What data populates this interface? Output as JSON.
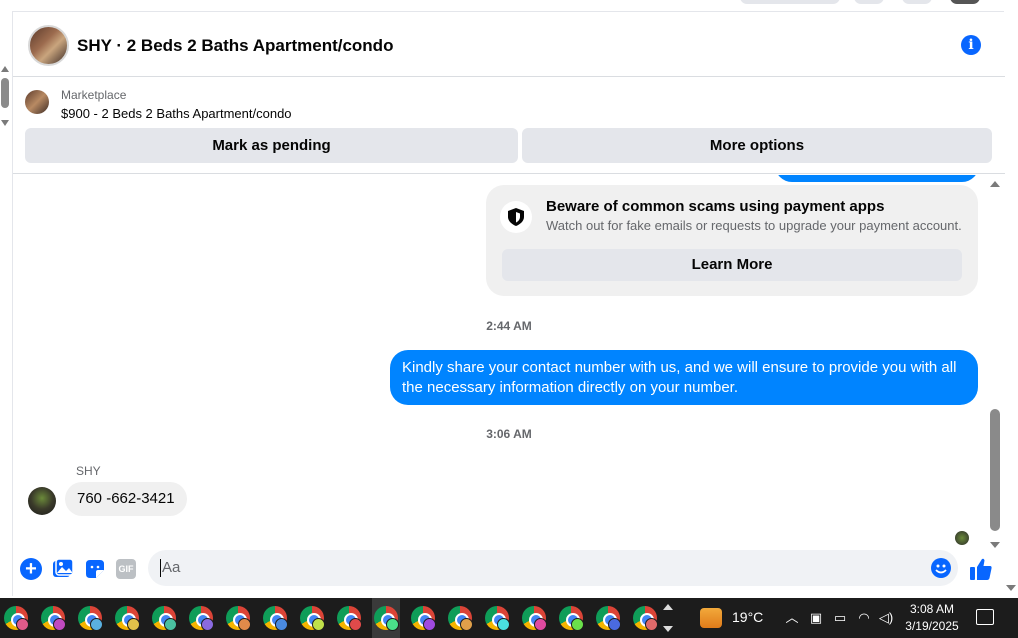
{
  "header": {
    "title": "SHY · 2 Beds 2 Baths Apartment/condo"
  },
  "listing": {
    "category": "Marketplace",
    "price_title": "$900 - 2 Beds 2 Baths Apartment/condo",
    "pending_label": "Mark as pending",
    "more_label": "More options"
  },
  "scam_notice": {
    "title": "Beware of common scams using payment apps",
    "subtitle": "Watch out for fake emails or requests to upgrade your payment account.",
    "button": "Learn More"
  },
  "messages": {
    "time1": "2:44 AM",
    "outgoing": "Kindly share your contact number with us, and we will ensure to provide you with all the necessary information directly on your number.",
    "time2": "3:06 AM",
    "sender": "SHY",
    "incoming": "760 -662-3421"
  },
  "composer": {
    "placeholder": "Aa",
    "gif_label": "GIF"
  },
  "taskbar": {
    "temperature": "19°C",
    "time": "3:08 AM",
    "date": "3/19/2025",
    "badge_colors": [
      "#e05a8a",
      "#c04ac0",
      "#5ab0e0",
      "#e0c04a",
      "#4ac0a0",
      "#8a6ae0",
      "#e08a4a",
      "#4a8ae0",
      "#c0e04a",
      "#e04a4a",
      "#4ae08a",
      "#a04ae0",
      "#e0a04a",
      "#4ae0e0",
      "#e04aa0",
      "#6ae04a",
      "#4a6ae0",
      "#e06a6a"
    ]
  },
  "colors": {
    "accent": "#0866ff",
    "outgoing_bubble": "#0084ff",
    "incoming_bubble": "#f0f0f0"
  }
}
